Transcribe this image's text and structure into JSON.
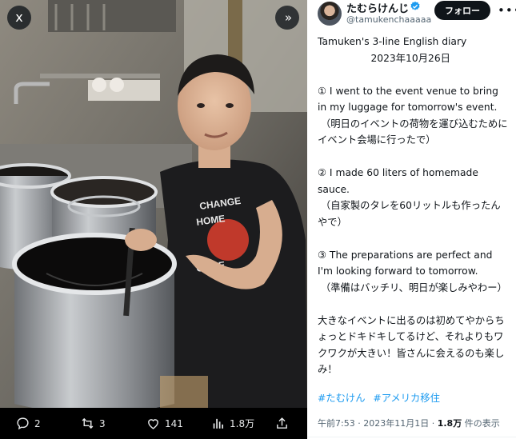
{
  "photo": {
    "close_icon": "x",
    "expand_icon": "»",
    "shirt_text": "CHANGE · HOME · GAME"
  },
  "actions": {
    "reply_count": "2",
    "repost_count": "3",
    "like_count": "141",
    "views_count": "1.8万"
  },
  "profile": {
    "display_name": "たむらけんじ",
    "handle": "@tamukenchaaaaa",
    "follow_label": "フォロー",
    "verified_color": "#1d9bf0"
  },
  "post": {
    "paragraphs": [
      "Tamuken's 3-line English diary\n                 2023年10月26日",
      "① I went to the event venue to bring in my luggage for tomorrow's event.\n （明日のイベントの荷物を運び込むためにイベント会場に行ったで）",
      "② I made 60 liters of homemade sauce.\n （自家製のタレを60リットルも作ったんやで）",
      "③ The preparations are perfect and I'm looking forward to tomorrow.\n （準備はバッチリ、明日が楽しみやわー）",
      "大きなイベントに出るのは初めてやからちょっとドキドキしてるけど、それよりもワクワクが大きい！皆さんに会えるのも楽しみ！"
    ],
    "hashtags": [
      "#たむけん",
      "#アメリカ移住"
    ]
  },
  "meta": {
    "time": "午前7:53",
    "date": "2023年11月1日",
    "views": "1.8万",
    "views_label": "件の表示"
  },
  "colors": {
    "link": "#1d9bf0",
    "text": "#0f1419",
    "muted": "#536471"
  }
}
